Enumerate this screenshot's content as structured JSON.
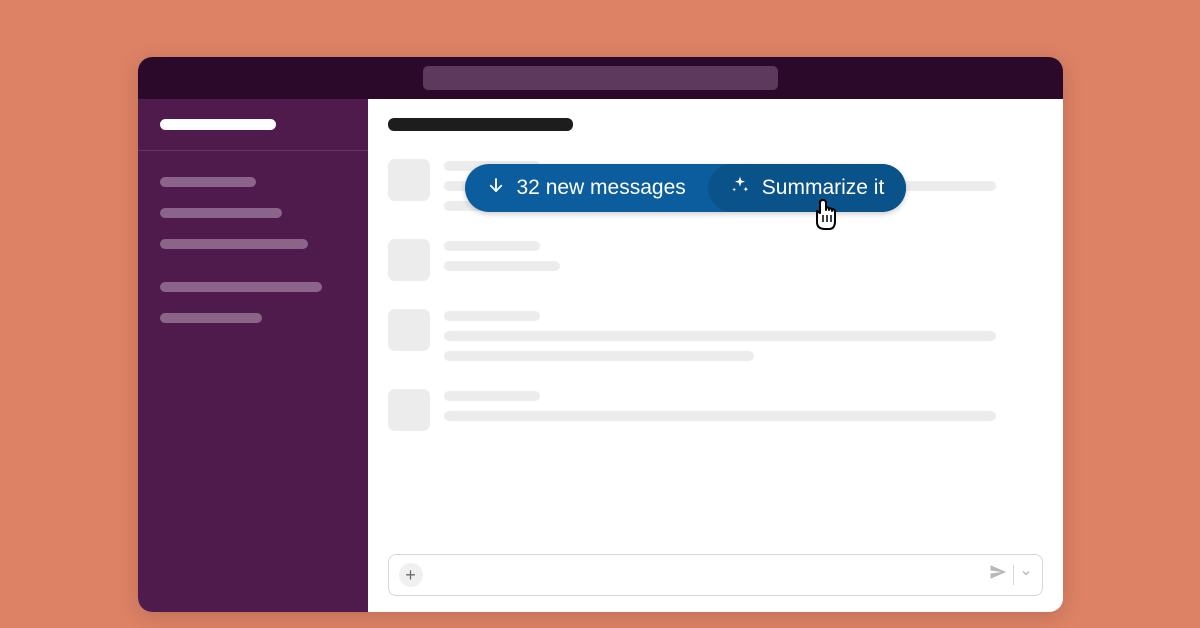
{
  "titlebar": {
    "search_placeholder": ""
  },
  "sidebar": {
    "workspace_name": "",
    "channel_widths": [
      96,
      122,
      148,
      162,
      102
    ]
  },
  "channel": {
    "title": ""
  },
  "pill": {
    "new_messages_label": "32 new messages",
    "summarize_label": "Summarize it",
    "icons": {
      "arrow": "arrow-down-icon",
      "sparkle": "sparkle-icon"
    }
  },
  "messages": [
    {
      "lines": [
        96,
        552,
        310
      ]
    },
    {
      "lines": [
        96,
        116
      ]
    },
    {
      "lines": [
        96,
        552,
        310
      ]
    },
    {
      "lines": [
        96,
        552
      ]
    }
  ],
  "composer": {
    "placeholder": "",
    "plus_label": "+",
    "send_label": "send"
  },
  "colors": {
    "background": "#dd8265",
    "titlebar": "#2a092a",
    "sidebar": "#4f1a4c",
    "pill": "#0b5d9e",
    "pill_dark": "#0a528a"
  }
}
